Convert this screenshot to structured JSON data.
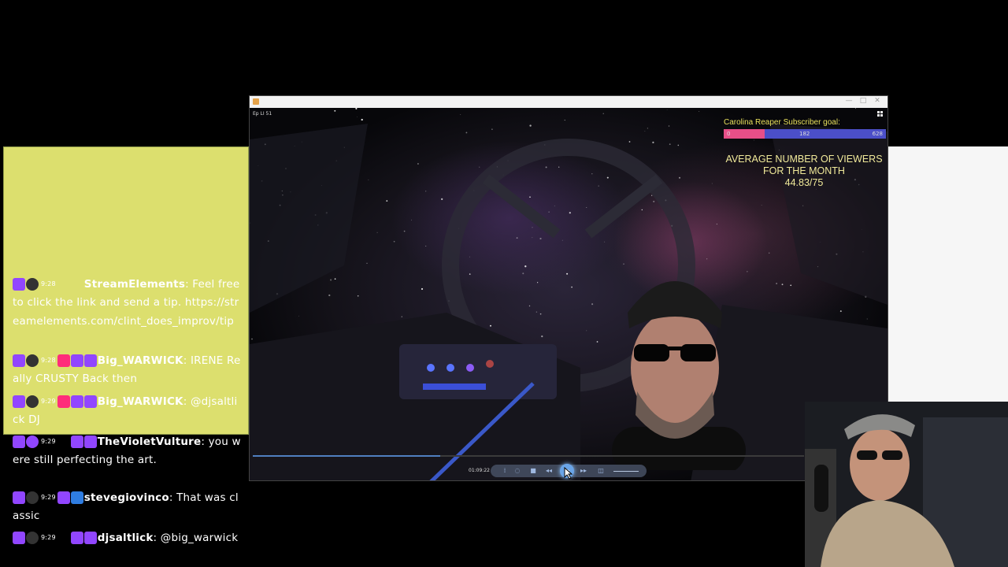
{
  "player": {
    "video_label": "Ep LI 51",
    "time": "01:09:22",
    "progress_fraction": 0.34,
    "icons": [
      "app-icon",
      "minimize-icon",
      "maximize-icon",
      "close-icon",
      "grid-icon",
      "chapter-icon",
      "loop-icon",
      "stop-icon",
      "rewind-icon",
      "play-icon",
      "forward-icon",
      "screenshot-icon",
      "volume-icon"
    ],
    "window_buttons": [
      "—",
      "□",
      "✕"
    ]
  },
  "overlay": {
    "goal_title": "Carolina Reaper Subscriber goal:",
    "goal_start": "0",
    "goal_current": "182",
    "goal_target": "628",
    "goal_fraction": 0.25,
    "avg_line1": "AVERAGE NUMBER OF VIEWERS",
    "avg_line2": "FOR THE MONTH",
    "avg_value": "44.83/75",
    "goal_color": "#e74f88",
    "goal_track_color": "#4b4fc8"
  },
  "chat": [
    {
      "time": "9:28",
      "user": "StreamElements",
      "text": " Feel free to click the link and send a tip. https://streamelements.com/clint_does_improv/tip",
      "color": "#ffffff"
    },
    {
      "time": "9:28",
      "user": "Big_WARWICK",
      "text": " IRENE Really CRUSTY Back then",
      "color": "#ffffff"
    },
    {
      "time": "9:29",
      "user": "Big_WARWICK",
      "text": " @djsaltlick DJ",
      "color": "#ffffff"
    },
    {
      "time": "9:29",
      "user": "TheVioletVulture",
      "text": " you were still perfecting the art.",
      "color": "#ffffff"
    },
    {
      "time": "9:29",
      "user": "stevegiovinco",
      "text": " That was classic",
      "color": "#ffffff"
    },
    {
      "time": "9:29",
      "user": "djsaltlick",
      "text": " @big_warwick",
      "color": "#ffffff"
    }
  ],
  "colors": {
    "chat_highlight": "#dcdf6e",
    "accent": "#9146ff",
    "progress": "#4f7fc0"
  }
}
